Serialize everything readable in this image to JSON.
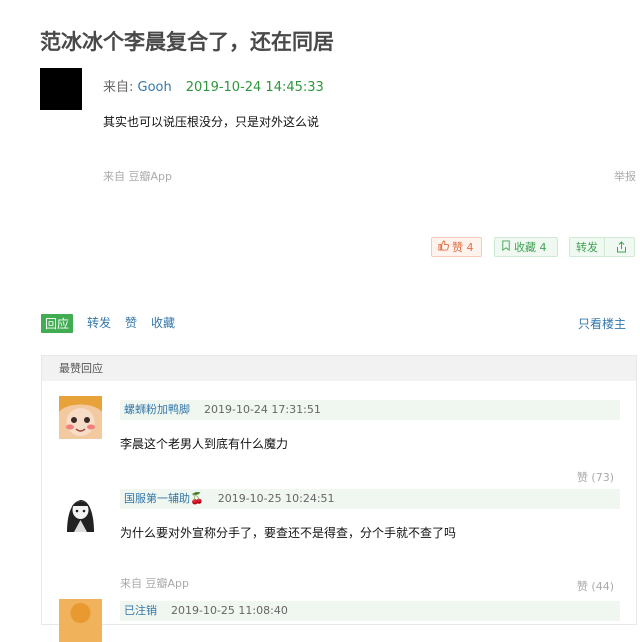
{
  "post": {
    "title": "范冰冰个李晨复合了，还在同居",
    "from_prefix": "来自: ",
    "author": "Gooh",
    "date": "2019-10-24 14:45:33",
    "content": "其实也可以说压根没分，只是对外这么说",
    "source": "来自 豆瓣App",
    "report": "举报"
  },
  "actions": {
    "like_label": "赞 4",
    "collect_label": "收藏 4",
    "share_label": "转发"
  },
  "tabs": {
    "items": [
      "回应",
      "转发",
      "赞",
      "收藏"
    ],
    "only_op": "只看楼主"
  },
  "comments_section": {
    "title": "最赞回应",
    "items": [
      {
        "name": "螺蛳粉加鸭脚",
        "time": "2019-10-24 17:31:51",
        "text": "李晨这个老男人到底有什么魔力",
        "likes": "赞 (73)",
        "source": ""
      },
      {
        "name": "国服第一辅助🍒",
        "time": "2019-10-25 10:24:51",
        "text": "为什么要对外宣称分手了，要查还不是得查，分个手就不查了吗",
        "likes": "赞 (44)",
        "source": "来自 豆瓣App"
      },
      {
        "name": "已注销",
        "time": "2019-10-25 11:08:40",
        "text": "",
        "likes": "",
        "source": ""
      }
    ]
  },
  "colors": {
    "link": "#3377aa",
    "green": "#2e963d",
    "like": "#e07046"
  }
}
